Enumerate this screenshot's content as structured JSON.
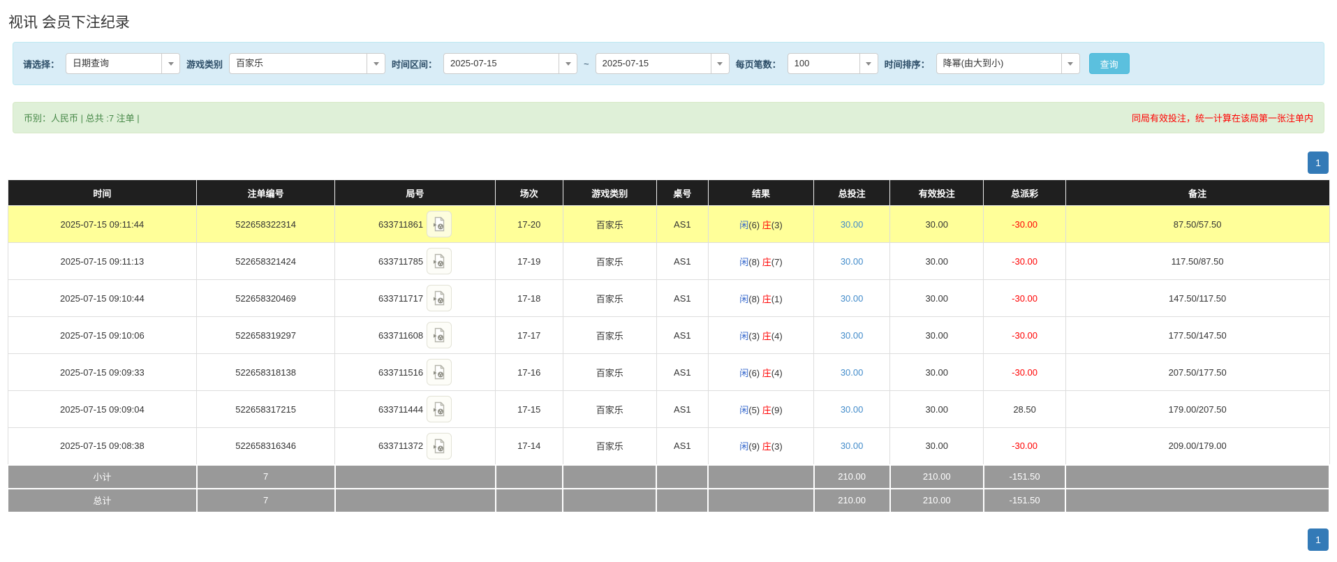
{
  "page": {
    "title": "视讯 会员下注纪录"
  },
  "filters": {
    "select_label": "请选择：",
    "select_value": "日期查询",
    "game_label": "游戏类别",
    "game_value": "百家乐",
    "range_label": "时间区间：",
    "date_from": "2025-07-15",
    "tilde": "~",
    "date_to": "2025-07-15",
    "per_page_label": "每页笔数：",
    "per_page_value": "100",
    "sort_label": "时间排序：",
    "sort_value": "降幂(由大到小)",
    "search_button": "查询"
  },
  "summary_bar": {
    "left_text": "币别：人民币 | 总共 :7 注单 |",
    "right_text": "同局有效投注，统一计算在该局第一张注单内"
  },
  "pagination": {
    "page": "1"
  },
  "icons": {
    "dropdown_caret": "chevron-down",
    "round_video": "video-file-icon"
  },
  "colors": {
    "header_bg": "#1f1f1f",
    "highlight_row": "#ffff99",
    "link_blue": "#428bca",
    "negative_red": "#ff0000",
    "player_blue": "#3366cc",
    "banker_red": "#ff0000",
    "filter_bg": "#d9edf7",
    "success_bg": "#dff0d8",
    "success_text": "#468847",
    "search_button_bg": "#5bc0de",
    "pagination_blue": "#337ab7",
    "summary_row_bg": "#999999"
  },
  "table": {
    "headers": [
      "时间",
      "注单编号",
      "局号",
      "场次",
      "游戏类别",
      "桌号",
      "结果",
      "总投注",
      "有效投注",
      "总派彩",
      "备注"
    ],
    "rows": [
      {
        "time": "2025-07-15 09:11:44",
        "bet_id": "522658322314",
        "round_id": "633711861",
        "session": "17-20",
        "game": "百家乐",
        "table_no": "AS1",
        "result_p": "闲",
        "result_p_score": "(6)",
        "result_b": "庄",
        "result_b_score": "(3)",
        "total_bet": "30.00",
        "valid_bet": "30.00",
        "payout": "-30.00",
        "remark": "87.50/57.50"
      },
      {
        "time": "2025-07-15 09:11:13",
        "bet_id": "522658321424",
        "round_id": "633711785",
        "session": "17-19",
        "game": "百家乐",
        "table_no": "AS1",
        "result_p": "闲",
        "result_p_score": "(8)",
        "result_b": "庄",
        "result_b_score": "(7)",
        "total_bet": "30.00",
        "valid_bet": "30.00",
        "payout": "-30.00",
        "remark": "117.50/87.50"
      },
      {
        "time": "2025-07-15 09:10:44",
        "bet_id": "522658320469",
        "round_id": "633711717",
        "session": "17-18",
        "game": "百家乐",
        "table_no": "AS1",
        "result_p": "闲",
        "result_p_score": "(8)",
        "result_b": "庄",
        "result_b_score": "(1)",
        "total_bet": "30.00",
        "valid_bet": "30.00",
        "payout": "-30.00",
        "remark": "147.50/117.50"
      },
      {
        "time": "2025-07-15 09:10:06",
        "bet_id": "522658319297",
        "round_id": "633711608",
        "session": "17-17",
        "game": "百家乐",
        "table_no": "AS1",
        "result_p": "闲",
        "result_p_score": "(3)",
        "result_b": "庄",
        "result_b_score": "(4)",
        "total_bet": "30.00",
        "valid_bet": "30.00",
        "payout": "-30.00",
        "remark": "177.50/147.50"
      },
      {
        "time": "2025-07-15 09:09:33",
        "bet_id": "522658318138",
        "round_id": "633711516",
        "session": "17-16",
        "game": "百家乐",
        "table_no": "AS1",
        "result_p": "闲",
        "result_p_score": "(6)",
        "result_b": "庄",
        "result_b_score": "(4)",
        "total_bet": "30.00",
        "valid_bet": "30.00",
        "payout": "-30.00",
        "remark": "207.50/177.50"
      },
      {
        "time": "2025-07-15 09:09:04",
        "bet_id": "522658317215",
        "round_id": "633711444",
        "session": "17-15",
        "game": "百家乐",
        "table_no": "AS1",
        "result_p": "闲",
        "result_p_score": "(5)",
        "result_b": "庄",
        "result_b_score": "(9)",
        "total_bet": "30.00",
        "valid_bet": "30.00",
        "payout": "28.50",
        "remark": "179.00/207.50"
      },
      {
        "time": "2025-07-15 09:08:38",
        "bet_id": "522658316346",
        "round_id": "633711372",
        "session": "17-14",
        "game": "百家乐",
        "table_no": "AS1",
        "result_p": "闲",
        "result_p_score": "(9)",
        "result_b": "庄",
        "result_b_score": "(3)",
        "total_bet": "30.00",
        "valid_bet": "30.00",
        "payout": "-30.00",
        "remark": "209.00/179.00"
      }
    ],
    "subtotal": {
      "label": "小计",
      "count": "7",
      "total_bet": "210.00",
      "valid_bet": "210.00",
      "payout": "-151.50"
    },
    "total": {
      "label": "总计",
      "count": "7",
      "total_bet": "210.00",
      "valid_bet": "210.00",
      "payout": "-151.50"
    }
  }
}
